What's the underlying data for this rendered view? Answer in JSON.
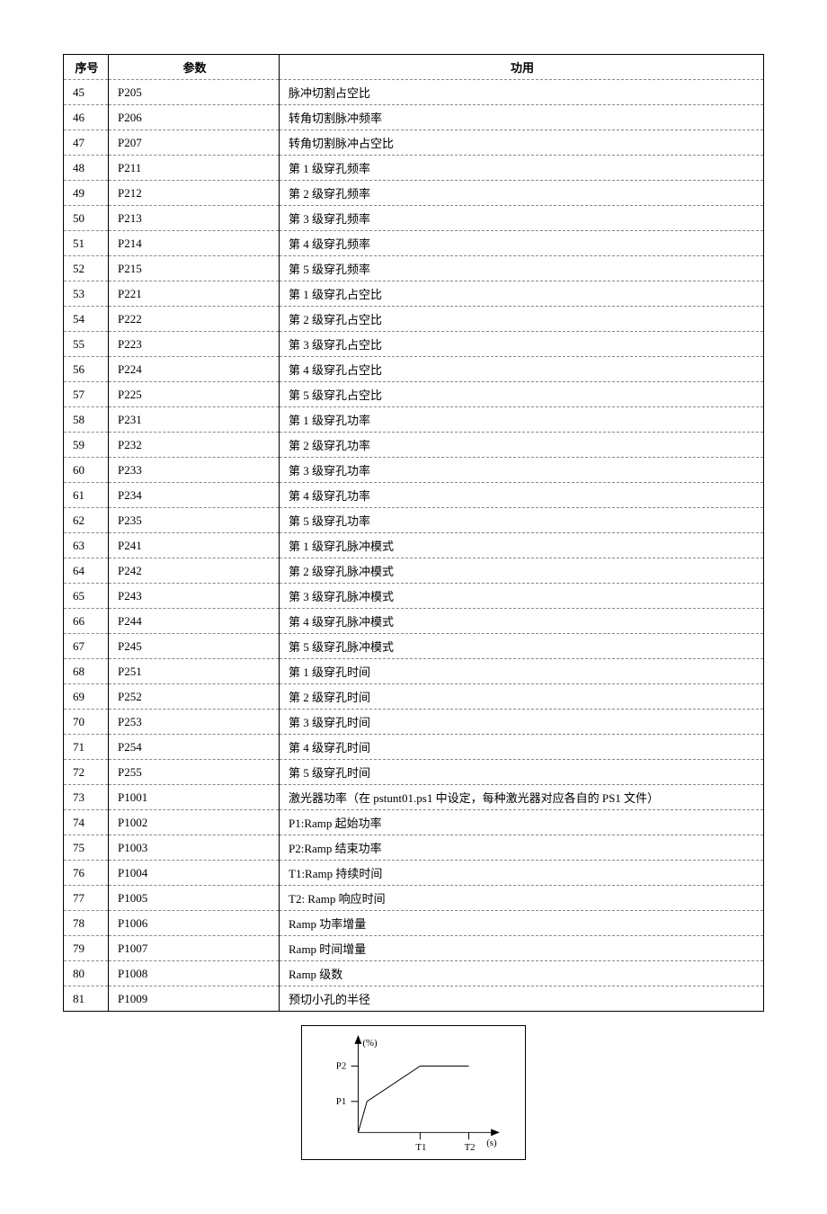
{
  "table": {
    "headers": {
      "seq": "序号",
      "param": "参数",
      "func": "功用"
    },
    "rows": [
      {
        "seq": "45",
        "param": "P205",
        "func": "脉冲切割占空比"
      },
      {
        "seq": "46",
        "param": "P206",
        "func": "转角切割脉冲频率"
      },
      {
        "seq": "47",
        "param": "P207",
        "func": "转角切割脉冲占空比"
      },
      {
        "seq": "48",
        "param": "P211",
        "func": "第 1 级穿孔频率"
      },
      {
        "seq": "49",
        "param": "P212",
        "func": "第 2 级穿孔频率"
      },
      {
        "seq": "50",
        "param": "P213",
        "func": "第 3 级穿孔频率"
      },
      {
        "seq": "51",
        "param": "P214",
        "func": "第 4 级穿孔频率"
      },
      {
        "seq": "52",
        "param": "P215",
        "func": "第 5 级穿孔频率"
      },
      {
        "seq": "53",
        "param": "P221",
        "func": "第 1 级穿孔占空比"
      },
      {
        "seq": "54",
        "param": "P222",
        "func": "第 2 级穿孔占空比"
      },
      {
        "seq": "55",
        "param": "P223",
        "func": "第 3 级穿孔占空比"
      },
      {
        "seq": "56",
        "param": "P224",
        "func": "第 4 级穿孔占空比"
      },
      {
        "seq": "57",
        "param": "P225",
        "func": "第 5 级穿孔占空比"
      },
      {
        "seq": "58",
        "param": "P231",
        "func": "第 1 级穿孔功率"
      },
      {
        "seq": "59",
        "param": "P232",
        "func": "第 2 级穿孔功率"
      },
      {
        "seq": "60",
        "param": "P233",
        "func": "第 3 级穿孔功率"
      },
      {
        "seq": "61",
        "param": "P234",
        "func": "第 4 级穿孔功率"
      },
      {
        "seq": "62",
        "param": "P235",
        "func": "第 5 级穿孔功率"
      },
      {
        "seq": "63",
        "param": "P241",
        "func": "第 1 级穿孔脉冲模式"
      },
      {
        "seq": "64",
        "param": "P242",
        "func": "第 2 级穿孔脉冲模式"
      },
      {
        "seq": "65",
        "param": "P243",
        "func": "第 3 级穿孔脉冲模式"
      },
      {
        "seq": "66",
        "param": "P244",
        "func": "第 4 级穿孔脉冲模式"
      },
      {
        "seq": "67",
        "param": "P245",
        "func": "第 5 级穿孔脉冲模式"
      },
      {
        "seq": "68",
        "param": "P251",
        "func": "第 1 级穿孔时间"
      },
      {
        "seq": "69",
        "param": "P252",
        "func": "第 2 级穿孔时间"
      },
      {
        "seq": "70",
        "param": "P253",
        "func": "第 3 级穿孔时间"
      },
      {
        "seq": "71",
        "param": "P254",
        "func": "第 4 级穿孔时间"
      },
      {
        "seq": "72",
        "param": "P255",
        "func": "第 5 级穿孔时间"
      },
      {
        "seq": "73",
        "param": "P1001",
        "func": "激光器功率（在 pstunt01.ps1 中设定，每种激光器对应各自的 PS1 文件）"
      },
      {
        "seq": "74",
        "param": "P1002",
        "func": "P1:Ramp 起始功率"
      },
      {
        "seq": "75",
        "param": "P1003",
        "func": "P2:Ramp 结束功率"
      },
      {
        "seq": "76",
        "param": "P1004",
        "func": "T1:Ramp 持续时间"
      },
      {
        "seq": "77",
        "param": "P1005",
        "func": "T2: Ramp 响应时间"
      },
      {
        "seq": "78",
        "param": "P1006",
        "func": "Ramp 功率增量"
      },
      {
        "seq": "79",
        "param": "P1007",
        "func": "Ramp 时间增量"
      },
      {
        "seq": "80",
        "param": "P1008",
        "func": "Ramp 级数"
      },
      {
        "seq": "81",
        "param": "P1009",
        "func": "预切小孔的半径"
      }
    ]
  },
  "chart_data": {
    "type": "line",
    "ylabel": "(%)",
    "xlabel": "(s)",
    "y_ticks": [
      "P2",
      "P1"
    ],
    "x_ticks": [
      "T1",
      "T2"
    ],
    "description": "Ramp curve rising from P1 to P2 over time T1 then continues toward T2"
  }
}
